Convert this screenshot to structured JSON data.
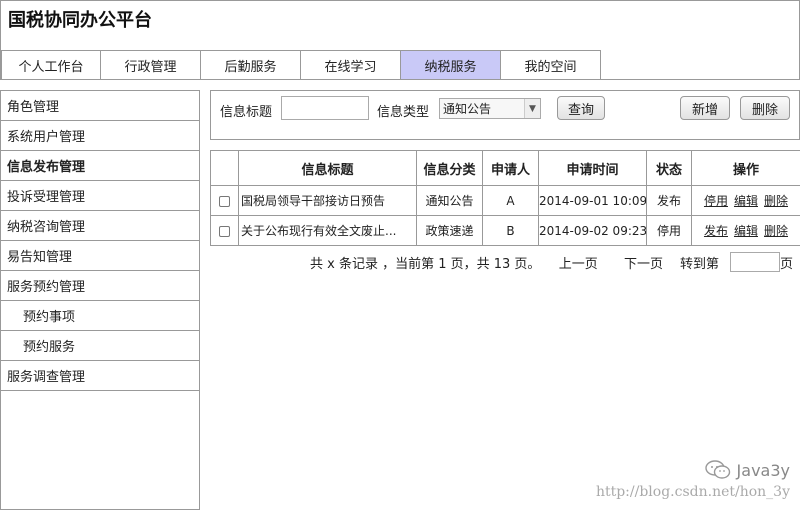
{
  "app": {
    "title": "国税协同办公平台"
  },
  "nav": {
    "tabs": [
      {
        "label": "个人工作台",
        "active": false
      },
      {
        "label": "行政管理",
        "active": false
      },
      {
        "label": "后勤服务",
        "active": false
      },
      {
        "label": "在线学习",
        "active": false
      },
      {
        "label": "纳税服务",
        "active": true
      },
      {
        "label": "我的空间",
        "active": false
      }
    ]
  },
  "sidebar": {
    "items": [
      {
        "label": "角色管理"
      },
      {
        "label": "系统用户管理"
      },
      {
        "label": "信息发布管理",
        "bold": true
      },
      {
        "label": "投诉受理管理"
      },
      {
        "label": "纳税咨询管理"
      },
      {
        "label": "易告知管理"
      },
      {
        "label": "服务预约管理"
      },
      {
        "label": "预约事项",
        "sub": true
      },
      {
        "label": "预约服务",
        "sub": true
      },
      {
        "label": "服务调查管理"
      }
    ]
  },
  "search": {
    "title_label": "信息标题",
    "title_value": "",
    "type_label": "信息类型",
    "type_value": "通知公告",
    "query_button": "查询",
    "add_button": "新增",
    "delete_button": "删除"
  },
  "table": {
    "headers": [
      "",
      "信息标题",
      "信息分类",
      "申请人",
      "申请时间",
      "状态",
      "操作"
    ],
    "rows": [
      {
        "title": "国税局领导干部接访日预告",
        "category": "通知公告",
        "applicant": "A",
        "time": "2014-09-01 10:09",
        "status": "发布",
        "ops": [
          "停用",
          "编辑",
          "删除"
        ]
      },
      {
        "title": "关于公布现行有效全文废止...",
        "category": "政策速递",
        "applicant": "B",
        "time": "2014-09-02 09:23",
        "status": "停用",
        "ops": [
          "发布",
          "编辑",
          "删除"
        ]
      }
    ]
  },
  "pager": {
    "summary": "共 x 条记录 ，当前第 1 页，共 13 页。",
    "prev": "上一页",
    "next": "下一页",
    "goto_label": "转到第",
    "goto_unit": "页"
  },
  "watermark": {
    "brand": "Java3y",
    "url": "http://blog.csdn.net/hon_3y"
  }
}
